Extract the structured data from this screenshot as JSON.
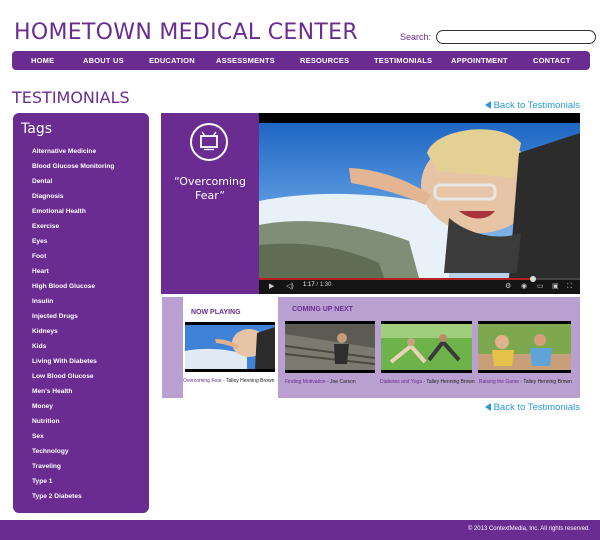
{
  "header": {
    "site_title": "HOMETOWN MEDICAL CENTER",
    "search_label": "Search:",
    "search_value": ""
  },
  "nav": {
    "items": [
      "HOME",
      "ABOUT US",
      "EDUCATION",
      "ASSESSMENTS",
      "RESOURCES",
      "TESTIMONIALS",
      "APPOINTMENT",
      "CONTACT"
    ]
  },
  "page": {
    "section_title": "TESTIMONIALS",
    "back_link": "Back to Testimonials"
  },
  "tags": {
    "title": "Tags",
    "items": [
      "Alternative Medicine",
      "Blood Glucose Monitoring",
      "Dental",
      "Diagnosis",
      "Emotional Health",
      "Exercise",
      "Eyes",
      "Foot",
      "Heart",
      "High Blood Glucose",
      "Insulin",
      "Injected Drugs",
      "Kidneys",
      "Kids",
      "Living With Diabetes",
      "Low Blood Glucose",
      "Men's Health",
      "Money",
      "Nutrition",
      "Sex",
      "Technology",
      "Traveling",
      "Type 1",
      "Type 2 Diabetes"
    ]
  },
  "video": {
    "title": "“Overcoming Fear”",
    "current_time": "1:17",
    "duration": "1:30",
    "progress": 0.855
  },
  "playlist": {
    "now_playing_label": "NOW PLAYING",
    "coming_up_label": "COMING UP NEXT",
    "now_playing": {
      "title": "Overcoming Fear",
      "author": "Talley Henning Brown"
    },
    "up_next": [
      {
        "title": "Finding Motivation",
        "author": "Joe Carson"
      },
      {
        "title": "Diabetes and Yoga",
        "author": "Talley Henning Brown"
      },
      {
        "title": "Raising the Game",
        "author": "Talley Henning Brown"
      }
    ]
  },
  "footer": {
    "copyright": "© 2013 ContextMedia, Inc. All rights reserved."
  },
  "colors": {
    "brand_purple": "#6a2c91",
    "light_purple": "#b9a0d0",
    "link_blue": "#2a9ad6"
  }
}
